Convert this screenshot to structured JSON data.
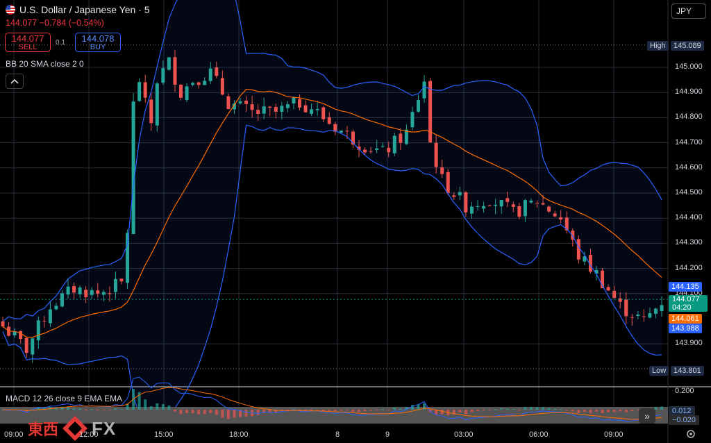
{
  "header": {
    "symbol_title": "U.S. Dollar / Japanese Yen · 5",
    "quote_line": "144.077  −0.784 (−0.54%)",
    "sell_price": "144.077",
    "sell_label": "SELL",
    "buy_price": "144.078",
    "buy_label": "BUY",
    "spread": "0.1",
    "currency_button": "JPY"
  },
  "indicators": {
    "bb_label": "BB 20 SMA close 2 0",
    "macd_label": "MACD 12 26 close 9 EMA EMA"
  },
  "price_axis": {
    "ticks": [
      "145.000",
      "144.900",
      "144.800",
      "144.700",
      "144.600",
      "144.500",
      "144.400",
      "144.300",
      "144.200",
      "144.100",
      "143.900"
    ],
    "high_label": "High",
    "high_value": "145.089",
    "low_label": "Low",
    "low_value": "143.801",
    "bb_upper": "144.135",
    "last_price": "144.077",
    "countdown": "04:20",
    "bb_basis": "144.061",
    "bb_lower": "143.988"
  },
  "macd_axis": {
    "tick": "0.200",
    "macd_value": "0.012",
    "signal_value": "−0.020"
  },
  "time_axis": [
    "09:00",
    "12:00",
    "15:00",
    "18:00",
    "8",
    "9",
    "03:00",
    "06:00",
    "09:00"
  ],
  "logo": {
    "kanji": "東西",
    "text": "FX"
  },
  "colors": {
    "up": "#26a69a",
    "down": "#ef5350",
    "bb_band": "#2962ff",
    "bb_basis": "#ff6d00",
    "last_price": "#089981",
    "badge_blue": "#2962ff",
    "badge_orange": "#ff6d00"
  },
  "chart_data": {
    "type": "candlestick",
    "symbol": "USDJPY",
    "interval": "5",
    "ylim": [
      143.78,
      145.14
    ],
    "x_ticks": [
      "09:00",
      "12:00",
      "15:00",
      "18:00",
      "8",
      "9",
      "03:00",
      "06:00",
      "09:00"
    ],
    "close_series": [
      [
        0,
        143.97
      ],
      [
        4,
        143.88
      ],
      [
        8,
        144.05
      ],
      [
        12,
        144.12
      ],
      [
        16,
        144.1
      ],
      [
        20,
        144.14
      ],
      [
        21,
        144.35
      ],
      [
        22,
        144.85
      ],
      [
        23,
        144.95
      ],
      [
        24,
        144.85
      ],
      [
        25,
        144.78
      ],
      [
        26,
        144.95
      ],
      [
        28,
        145.02
      ],
      [
        30,
        144.9
      ],
      [
        32,
        144.95
      ],
      [
        35,
        144.98
      ],
      [
        38,
        144.86
      ],
      [
        42,
        144.82
      ],
      [
        46,
        144.82
      ],
      [
        50,
        144.86
      ],
      [
        52,
        144.84
      ],
      [
        55,
        144.78
      ],
      [
        60,
        144.7
      ],
      [
        64,
        144.66
      ],
      [
        68,
        144.74
      ],
      [
        71,
        144.95
      ],
      [
        72,
        144.7
      ],
      [
        74,
        144.55
      ],
      [
        78,
        144.45
      ],
      [
        82,
        144.48
      ],
      [
        86,
        144.42
      ],
      [
        90,
        144.47
      ],
      [
        94,
        144.4
      ],
      [
        97,
        144.25
      ],
      [
        100,
        144.18
      ],
      [
        104,
        144.05
      ],
      [
        108,
        143.99
      ],
      [
        111,
        144.07
      ]
    ]
  }
}
